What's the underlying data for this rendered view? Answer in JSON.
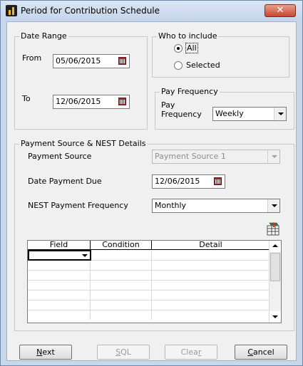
{
  "window": {
    "title": "Period for Contribution Schedule",
    "close_glyph": "✕"
  },
  "date_range": {
    "legend": "Date Range",
    "from_label": "From",
    "from_value": "05/06/2015",
    "to_label": "To",
    "to_value": "12/06/2015"
  },
  "who_to_include": {
    "legend": "Who to include",
    "options": [
      {
        "label": "All",
        "selected": true
      },
      {
        "label": "Selected",
        "selected": false
      }
    ]
  },
  "pay_frequency": {
    "legend": "Pay Frequency",
    "label_line1": "Pay",
    "label_line2": "Frequency",
    "value": "Weekly"
  },
  "payment_source_nest": {
    "legend": "Payment Source & NEST Details",
    "payment_source_label": "Payment Source",
    "payment_source_value": "Payment Source 1",
    "date_due_label": "Date Payment Due",
    "date_due_value": "12/06/2015",
    "nest_freq_label": "NEST Payment Frequency",
    "nest_freq_value": "Monthly"
  },
  "grid": {
    "columns": [
      "Field",
      "Condition",
      "Detail"
    ],
    "rows": [
      [
        "",
        "",
        ""
      ],
      [
        "",
        "",
        ""
      ],
      [
        "",
        "",
        ""
      ],
      [
        "",
        "",
        ""
      ],
      [
        "",
        "",
        ""
      ],
      [
        "",
        "",
        ""
      ],
      [
        "",
        "",
        ""
      ],
      [
        "",
        "",
        ""
      ]
    ]
  },
  "buttons": {
    "next": {
      "mnemonic": "N",
      "rest": "ext"
    },
    "sql": {
      "mnemonic": "S",
      "rest": "QL"
    },
    "clear": {
      "prefix": "Clea",
      "mnemonic": "r"
    },
    "cancel": {
      "mnemonic": "C",
      "rest": "ancel"
    }
  },
  "colors": {
    "title_bar": "#c4d4ea",
    "close_button": "#c9452e",
    "dialog_bg": "#f0f0f0",
    "calendar_icon": "#a6282b"
  }
}
